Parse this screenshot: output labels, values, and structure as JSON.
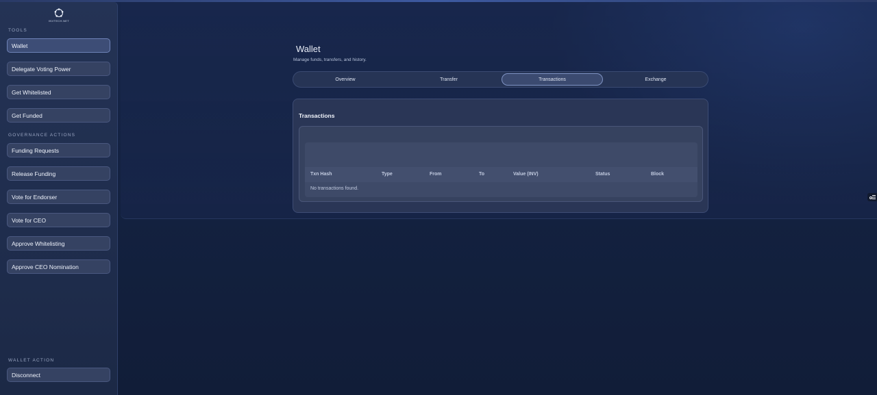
{
  "brand": {
    "logo_text": "INVTECH.NET"
  },
  "sidebar": {
    "tools_label": "TOOLS",
    "tools": [
      {
        "label": "Wallet"
      },
      {
        "label": "Delegate Voting Power"
      },
      {
        "label": "Get Whitelisted"
      },
      {
        "label": "Get Funded"
      }
    ],
    "governance_label": "GOVERNANCE ACTIONS",
    "governance": [
      {
        "label": "Funding Requests"
      },
      {
        "label": "Release Funding"
      },
      {
        "label": "Vote for Endorser"
      },
      {
        "label": "Vote for CEO"
      },
      {
        "label": "Approve Whitelisting"
      },
      {
        "label": "Approve CEO Nomination"
      }
    ],
    "wallet_action_label": "WALLET ACTION",
    "wallet_action": {
      "label": "Disconnect"
    },
    "active_item": "Wallet"
  },
  "main": {
    "title": "Wallet",
    "subtitle": "Manage funds, transfers, and history.",
    "tabs": [
      {
        "label": "Overview"
      },
      {
        "label": "Transfer"
      },
      {
        "label": "Transactions"
      },
      {
        "label": "Exchange"
      }
    ],
    "active_tab": "Transactions",
    "card": {
      "title": "Transactions",
      "columns": [
        "Txn Hash",
        "Type",
        "From",
        "To",
        "Value (INV)",
        "Status",
        "Block"
      ],
      "empty_message": "No transactions found."
    }
  },
  "icons": {
    "logo": "network-star-icon",
    "floating": "settings-sliders-icon"
  },
  "colors": {
    "background": "#13213f",
    "sidebar": "#243355",
    "button": "#354262",
    "active_border": "#7f93c4"
  }
}
